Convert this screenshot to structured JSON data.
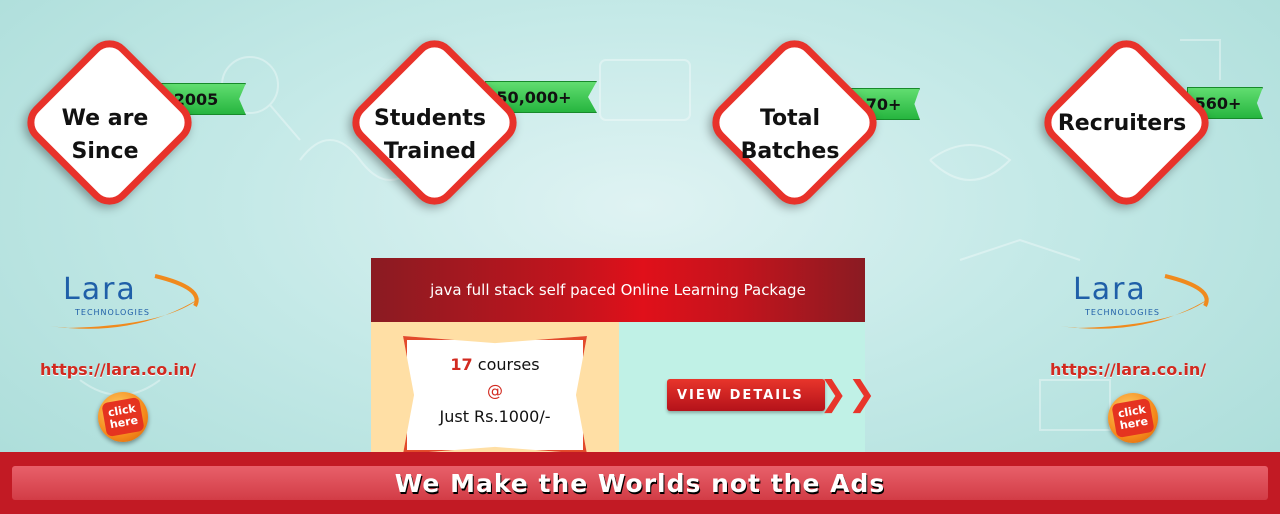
{
  "stats": [
    {
      "label": "We are\nSince",
      "badge": "2005"
    },
    {
      "label": "Students\nTrained",
      "badge": "50,000+"
    },
    {
      "label": "Total\nBatches",
      "badge": "170+"
    },
    {
      "label": "Recruiters",
      "badge": "560+"
    }
  ],
  "brand": {
    "logo_text": "Lara",
    "logo_sub": "TECHNOLOGIES",
    "url": "https://lara.co.in/",
    "click_label": "click\nhere"
  },
  "package": {
    "title": "java full stack self paced Online Learning Package",
    "courses_count": "17",
    "courses_label": "courses",
    "at_symbol": "@",
    "price": "Just Rs.1000/-",
    "view_button": "VIEW DETAILS",
    "chevrons": "❯❯"
  },
  "footer": {
    "tagline": "We Make  the Worlds not the Ads"
  },
  "colors": {
    "accent_red": "#e8322a",
    "ribbon_green": "#26b53f",
    "logo_blue": "#1f5fa8",
    "footer_red": "#c21a24"
  }
}
